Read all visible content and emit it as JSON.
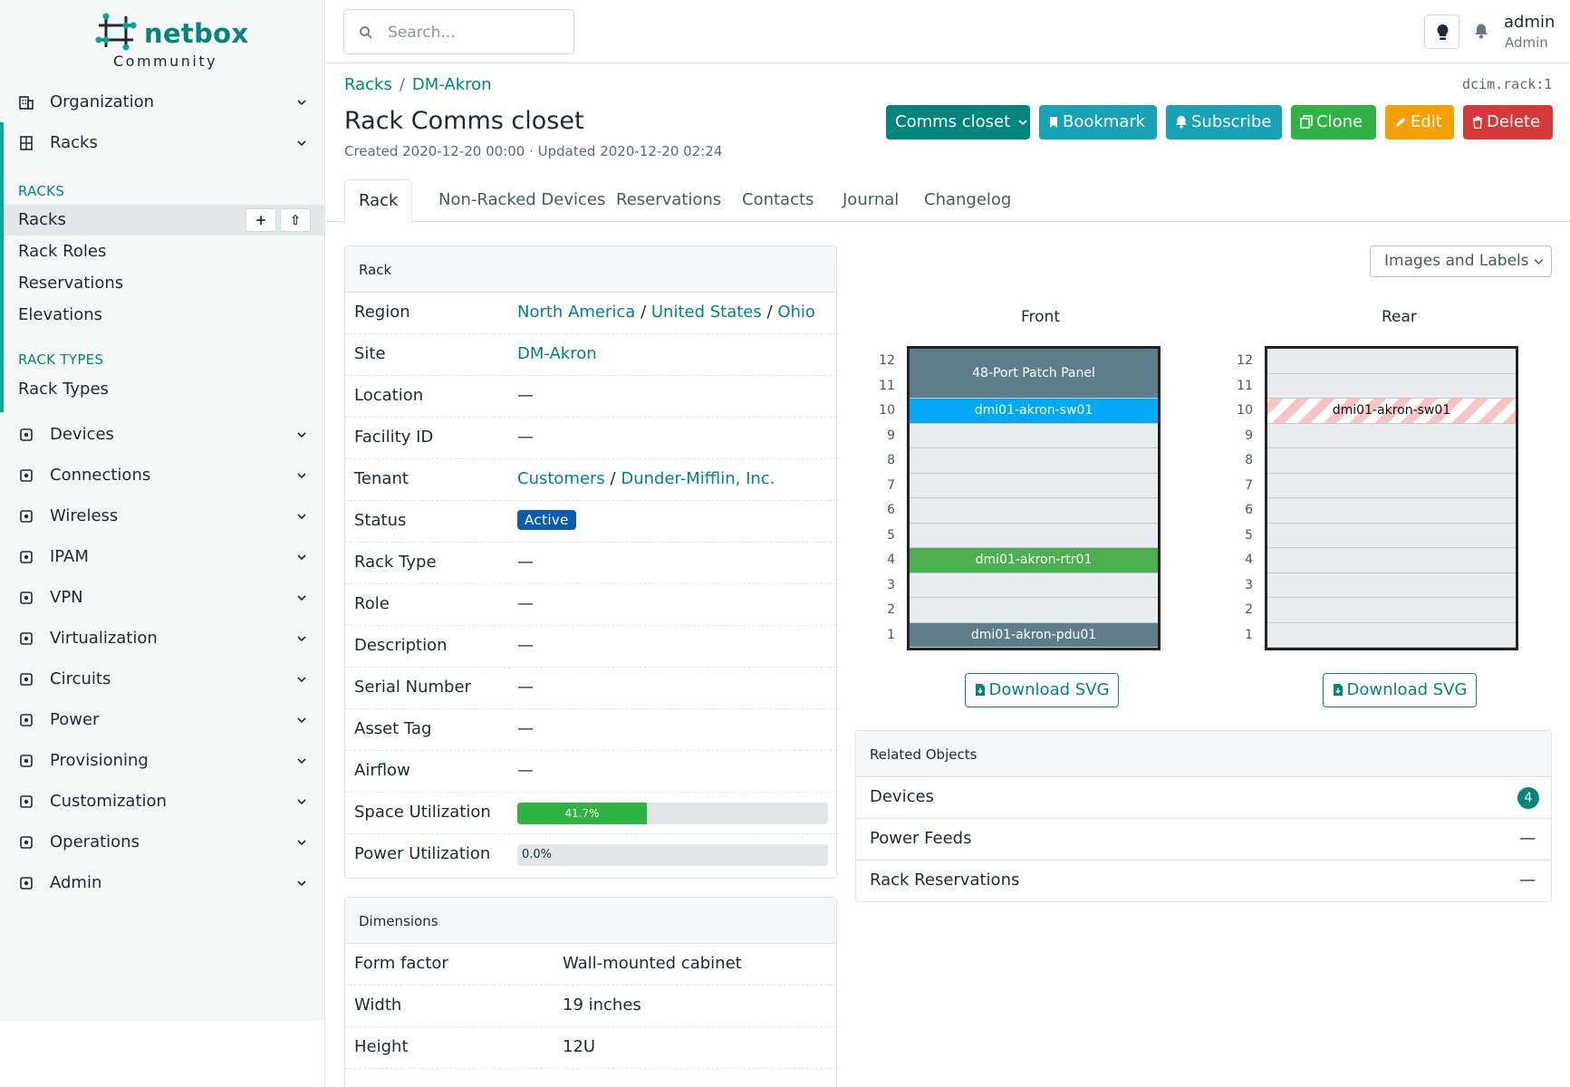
{
  "brand": {
    "name": "netbox",
    "edition": "Community"
  },
  "sidebar": {
    "top_items": [
      {
        "label": "Organization",
        "icon": "organization-icon"
      },
      {
        "label": "Racks",
        "icon": "rack-icon"
      }
    ],
    "racks_section": {
      "heading": "RACKS",
      "items": [
        "Racks",
        "Rack Roles",
        "Reservations",
        "Elevations"
      ],
      "add_button": "+",
      "import_button": "⇧"
    },
    "rack_types_section": {
      "heading": "RACK TYPES",
      "items": [
        "Rack Types"
      ]
    },
    "bottom_items": [
      {
        "label": "Devices"
      },
      {
        "label": "Connections"
      },
      {
        "label": "Wireless"
      },
      {
        "label": "IPAM"
      },
      {
        "label": "VPN"
      },
      {
        "label": "Virtualization"
      },
      {
        "label": "Circuits"
      },
      {
        "label": "Power"
      },
      {
        "label": "Provisioning"
      },
      {
        "label": "Customization"
      },
      {
        "label": "Operations"
      },
      {
        "label": "Admin"
      }
    ]
  },
  "topbar": {
    "search_placeholder": "Search...",
    "user": "admin",
    "role": "Admin"
  },
  "breadcrumb": {
    "items": [
      "Racks",
      "DM-Akron"
    ],
    "separator": "/"
  },
  "object_id": "dcim.rack:1",
  "page": {
    "title": "Rack Comms closet",
    "meta": "Created 2020-12-20 00:00 · Updated 2020-12-20 02:24"
  },
  "actions": {
    "rack_select": "Comms closet",
    "bookmark": "Bookmark",
    "subscribe": "Subscribe",
    "clone": "Clone",
    "edit": "Edit",
    "delete": "Delete",
    "colors": {
      "primary": "#00857d",
      "info": "#17a2b8",
      "success": "#2fb344",
      "warning": "#f59f00",
      "danger": "#d63939"
    }
  },
  "tabs": [
    "Rack",
    "Non-Racked Devices",
    "Reservations",
    "Contacts",
    "Journal",
    "Changelog"
  ],
  "rack_card": {
    "title": "Rack",
    "region": {
      "label": "Region",
      "parts": [
        "North America",
        "United States",
        "Ohio"
      ],
      "sep": "/"
    },
    "site": {
      "label": "Site",
      "value": "DM-Akron"
    },
    "location": {
      "label": "Location",
      "value": "—"
    },
    "facility_id": {
      "label": "Facility ID",
      "value": "—"
    },
    "tenant": {
      "label": "Tenant",
      "parts": [
        "Customers",
        "Dunder-Mifflin, Inc."
      ],
      "sep": "/"
    },
    "status": {
      "label": "Status",
      "value": "Active"
    },
    "rack_type": {
      "label": "Rack Type",
      "value": "—"
    },
    "role": {
      "label": "Role",
      "value": "—"
    },
    "description": {
      "label": "Description",
      "value": "—"
    },
    "serial": {
      "label": "Serial Number",
      "value": "—"
    },
    "asset_tag": {
      "label": "Asset Tag",
      "value": "—"
    },
    "airflow": {
      "label": "Airflow",
      "value": "—"
    },
    "space_util": {
      "label": "Space Utilization",
      "value": "41.7%",
      "percent": 41.7
    },
    "power_util": {
      "label": "Power Utilization",
      "value": "0.0%",
      "percent": 0
    }
  },
  "dimensions_card": {
    "title": "Dimensions",
    "rows": [
      {
        "label": "Form factor",
        "value": "Wall-mounted cabinet"
      },
      {
        "label": "Width",
        "value": "19 inches"
      },
      {
        "label": "Height",
        "value": "12U"
      }
    ]
  },
  "elevation": {
    "view_select": "Images and Labels",
    "front_title": "Front",
    "rear_title": "Rear",
    "units": [
      12,
      11,
      10,
      9,
      8,
      7,
      6,
      5,
      4,
      3,
      2,
      1
    ],
    "front_devices": [
      {
        "name": "48-Port Patch Panel",
        "top_u": 12,
        "height_u": 2,
        "color": "#607d8b"
      },
      {
        "name": "dmi01-akron-sw01",
        "top_u": 10,
        "height_u": 1,
        "color": "#03a9f4"
      },
      {
        "name": "dmi01-akron-rtr01",
        "top_u": 4,
        "height_u": 1,
        "color": "#4caf50"
      },
      {
        "name": "dmi01-akron-pdu01",
        "top_u": 1,
        "height_u": 1,
        "color": "#607d8b"
      }
    ],
    "rear_devices": [
      {
        "name": "dmi01-akron-sw01",
        "top_u": 10,
        "height_u": 1
      }
    ],
    "download_label": "Download SVG"
  },
  "related": {
    "title": "Related Objects",
    "items": [
      {
        "label": "Devices",
        "value": "4"
      },
      {
        "label": "Power Feeds",
        "value": "—"
      },
      {
        "label": "Rack Reservations",
        "value": "—"
      }
    ]
  }
}
